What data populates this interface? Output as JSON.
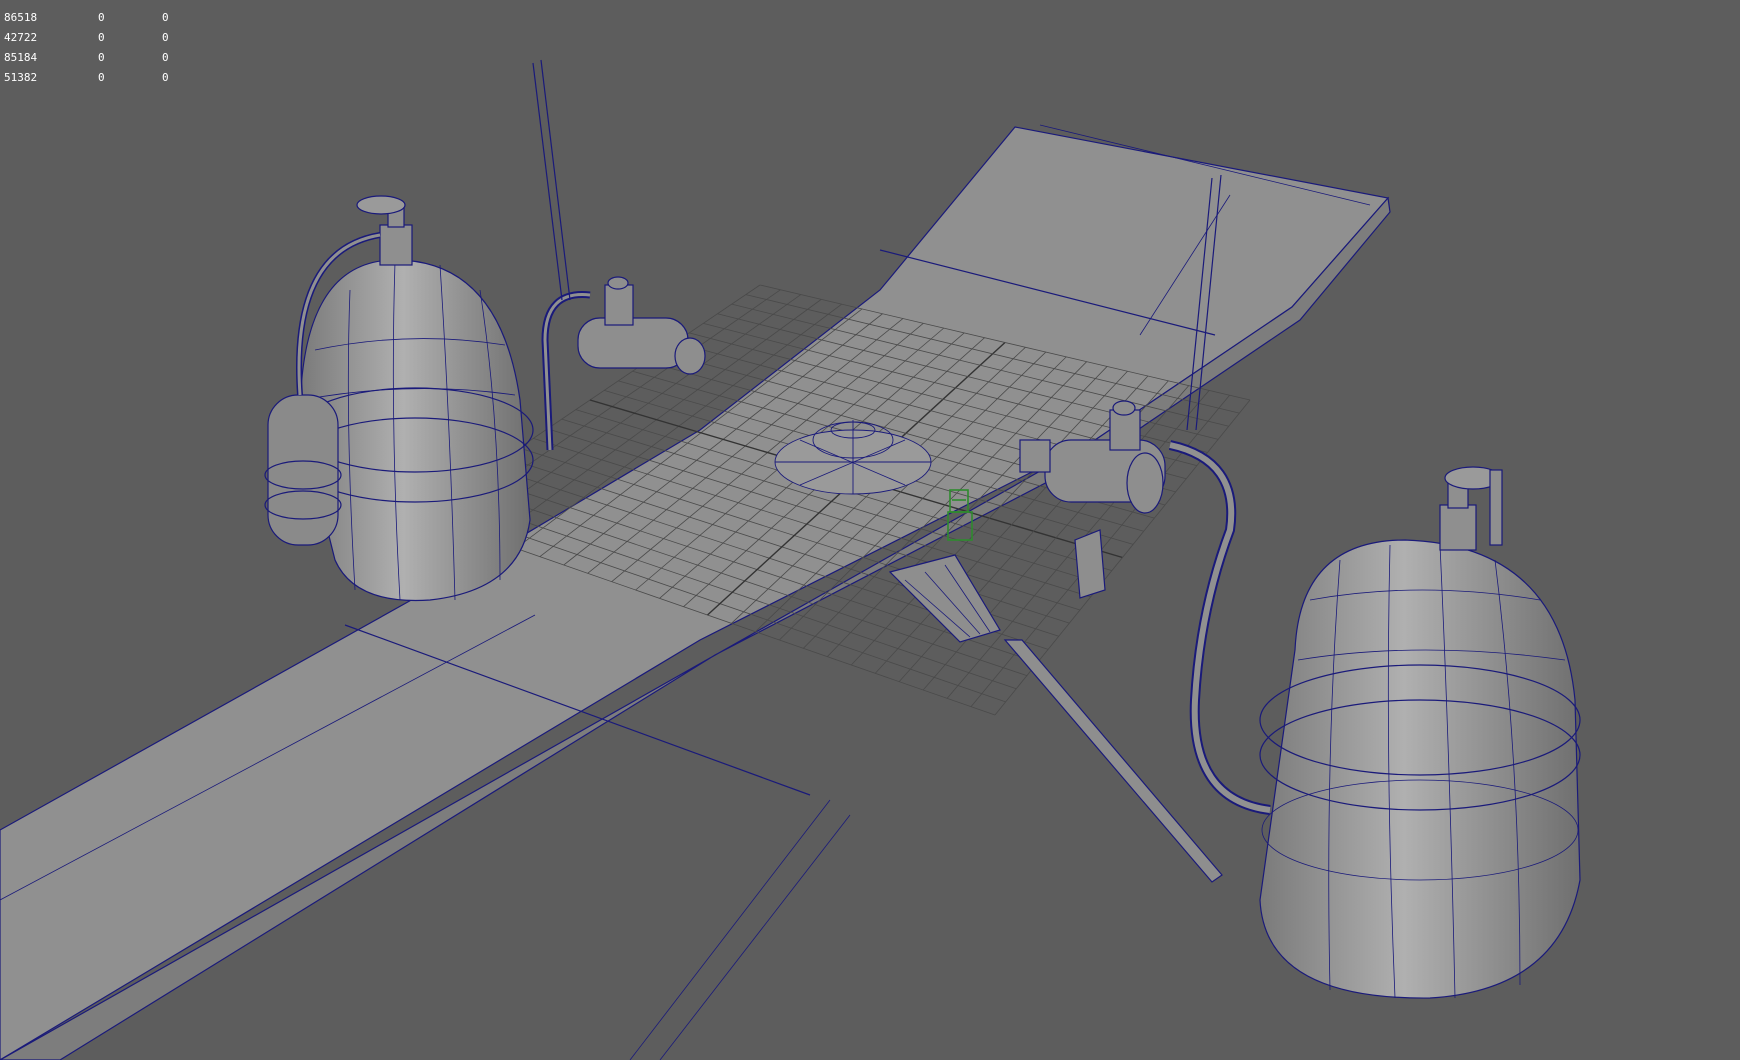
{
  "hud": {
    "rows": [
      {
        "a": "86518",
        "b": "0",
        "c": "0"
      },
      {
        "a": "42722",
        "b": "0",
        "c": "0"
      },
      {
        "a": "85184",
        "b": "0",
        "c": "0"
      },
      {
        "a": "51382",
        "b": "0",
        "c": "0"
      }
    ]
  },
  "colors": {
    "background": "#5d5d5d",
    "wireframe": "#1a1a7a",
    "surface": "#8f8f8f",
    "surface_light": "#a5a5a5",
    "selected": "#2e8b2e",
    "grid": "#444444"
  }
}
